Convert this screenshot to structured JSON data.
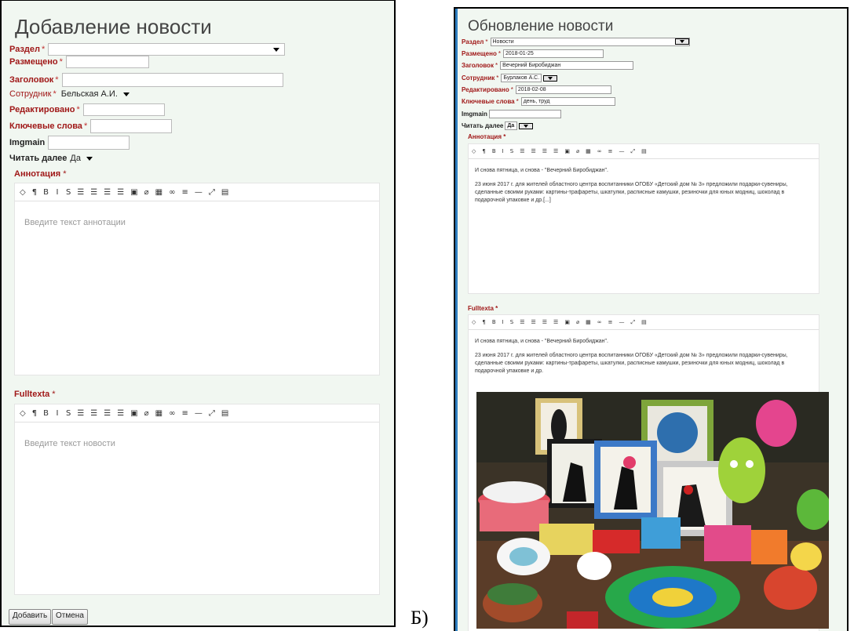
{
  "left": {
    "title": "Добавление новости",
    "fields": {
      "section": {
        "label": "Раздел",
        "value": ""
      },
      "placed": {
        "label": "Размещено"
      },
      "heading": {
        "label": "Заголовок"
      },
      "employee": {
        "label": "Сотрудник",
        "value": "Бельская А.И."
      },
      "edited": {
        "label": "Редактировано"
      },
      "keywords": {
        "label": "Ключевые слова"
      },
      "imgmain": {
        "label": "Imgmain"
      },
      "readmore": {
        "label": "Читать далее",
        "value": "Да"
      }
    },
    "required_mark": "*",
    "annotation_label": "Аннотация",
    "annotation_placeholder": "Введите текст аннотации",
    "fulltext_label": "Fulltexta",
    "fulltext_placeholder": "Введите текст новости",
    "buttons": {
      "add": "Добавить",
      "cancel": "Отмена"
    }
  },
  "letter": "Б)",
  "right": {
    "title": "Обновление новости",
    "fields": {
      "section": {
        "label": "Раздел",
        "value": "Новости"
      },
      "placed": {
        "label": "Размещено",
        "value": "2018-01-25"
      },
      "heading": {
        "label": "Заголовок",
        "value": "Вечерний Биробиджан"
      },
      "employee": {
        "label": "Сотрудник",
        "value": "Бурлаков А.С."
      },
      "edited": {
        "label": "Редактировано",
        "value": "2018-02-08"
      },
      "keywords": {
        "label": "Ключевые слова",
        "value": "день, труд"
      },
      "imgmain": {
        "label": "Imgmain",
        "value": ""
      },
      "readmore": {
        "label": "Читать далее",
        "value": "Да"
      }
    },
    "annotation_label": "Аннотация",
    "annotation_p1": "И снова пятница, и снова - \"Вечерний Биробиджан\".",
    "annotation_p2": "23 июня 2017 г. для жителей областного центра воспитанники ОГОБУ «Детский дом № 3» предложили подарки-сувениры, сделанные своими руками: картины-трафареты, шкатулки, расписные камушки, резиночки для юных модниц, шоколад в подарочной упаковке и др.[...]",
    "fulltext_label": "Fulltexta",
    "fulltext_p1": "И снова пятница, и снова - \"Вечерний Биробиджан\".",
    "fulltext_p2": "23 июня 2017 г. для жителей областного центра воспитанники ОГОБУ «Детский дом № 3» предложили подарки-сувениры, сделанные своими руками: картины-трафареты, шкатулки, расписные камушки, резиночки для юных модниц, шоколад в подарочной упаковке и др."
  },
  "toolbar_icons": [
    "code-icon",
    "paragraph-icon",
    "bold-icon",
    "italic-icon",
    "strikethrough-icon",
    "unordered-list-icon",
    "ordered-list-icon",
    "outdent-icon",
    "indent-icon",
    "image-icon",
    "link-icon",
    "table-icon",
    "video-icon",
    "align-icon",
    "horizontal-rule-icon",
    "fullscreen-icon",
    "html-icon"
  ],
  "toolbar_glyphs": [
    "◇",
    "¶",
    "B",
    "I",
    "S",
    "☰",
    "☰",
    "☰",
    "☰",
    "▣",
    "⌀",
    "▦",
    "∞",
    "≡",
    "—",
    "⤢",
    "▤"
  ],
  "colors": {
    "required": "#a01818",
    "panel_bg": "#f1f7f1",
    "accent_blue": "#2f7fc1"
  }
}
